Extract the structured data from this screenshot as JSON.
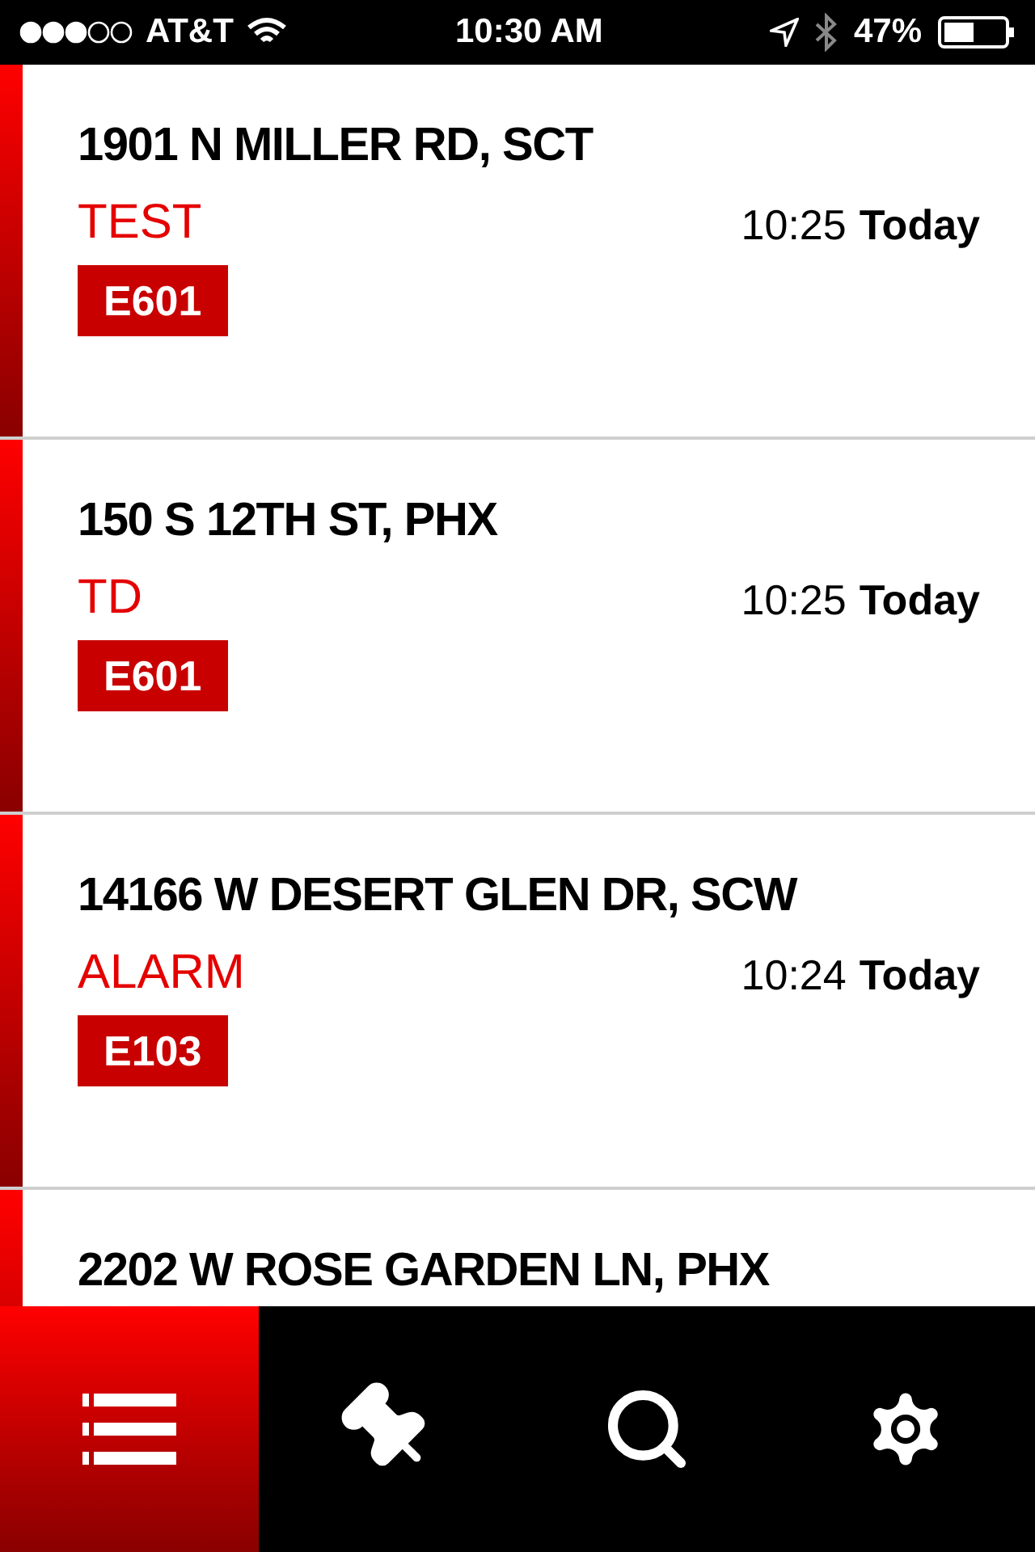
{
  "status_bar": {
    "carrier": "AT&T",
    "time": "10:30 AM",
    "battery": "47%"
  },
  "incidents": [
    {
      "address": "1901 N MILLER RD, SCT",
      "type": "TEST",
      "time": "10:25",
      "day": "Today",
      "unit": "E601"
    },
    {
      "address": "150 S 12TH ST, PHX",
      "type": "TD",
      "time": "10:25",
      "day": "Today",
      "unit": "E601"
    },
    {
      "address": "14166 W DESERT GLEN DR, SCW",
      "type": "ALARM",
      "time": "10:24",
      "day": "Today",
      "unit": "E103"
    },
    {
      "address": "2202 W ROSE GARDEN LN, PHX"
    }
  ],
  "tabs": [
    {
      "kind": "list",
      "selected": true
    },
    {
      "kind": "pin",
      "selected": false
    },
    {
      "kind": "search",
      "selected": false
    },
    {
      "kind": "settings",
      "selected": false
    }
  ]
}
